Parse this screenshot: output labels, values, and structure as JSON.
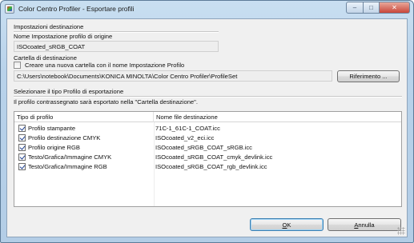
{
  "window": {
    "title": "Color Centro Profiler - Esportare profili",
    "controls": {
      "minimize": "–",
      "maximize": "□",
      "close": "✕"
    }
  },
  "destination": {
    "section_label": "Impostazioni destinazione",
    "source_name_label": "Nome Impostazione profilo di origine",
    "source_name_value": "ISOcoated_sRGB_COAT",
    "folder_label": "Cartella di destinazione",
    "new_folder_checkbox_label": "Creare una nuova cartella con il nome Impostazione Profilo",
    "new_folder_checked": false,
    "folder_path": "C:\\Users\\notebook\\Documents\\KONICA MINOLTA\\Color Centro Profiler\\ProfileSet",
    "browse_button": "Riferimento ..."
  },
  "export": {
    "select_label": "Selezionare il tipo Profilo di esportazione",
    "info_text": "Il profilo contrassegnato sarà esportato nella \"Cartella destinazione\".",
    "columns": [
      "Tipo di profilo",
      "Nome file destinazione"
    ],
    "rows": [
      {
        "tipo": "Profilo stampante",
        "file": "71C-1_61C-1_COAT.icc",
        "checked": true
      },
      {
        "tipo": "Profilo destinazione CMYK",
        "file": "ISOcoated_v2_eci.icc",
        "checked": true
      },
      {
        "tipo": "Profilo origine RGB",
        "file": "ISOcoated_sRGB_COAT_sRGB.icc",
        "checked": true
      },
      {
        "tipo": "Testo/Grafica/Immagine CMYK",
        "file": "ISOcoated_sRGB_COAT_cmyk_devlink.icc",
        "checked": true
      },
      {
        "tipo": "Testo/Grafica/Immagine RGB",
        "file": "ISOcoated_sRGB_COAT_rgb_devlink.icc",
        "checked": true
      }
    ]
  },
  "buttons": {
    "ok_mnemonic": "O",
    "ok_rest": "K",
    "cancel_mnemonic": "A",
    "cancel_rest": "nnulla"
  },
  "icons": [
    "app-icon",
    "minimize-icon",
    "maximize-icon",
    "close-icon",
    "checkbox",
    "resize-grip-icon"
  ]
}
